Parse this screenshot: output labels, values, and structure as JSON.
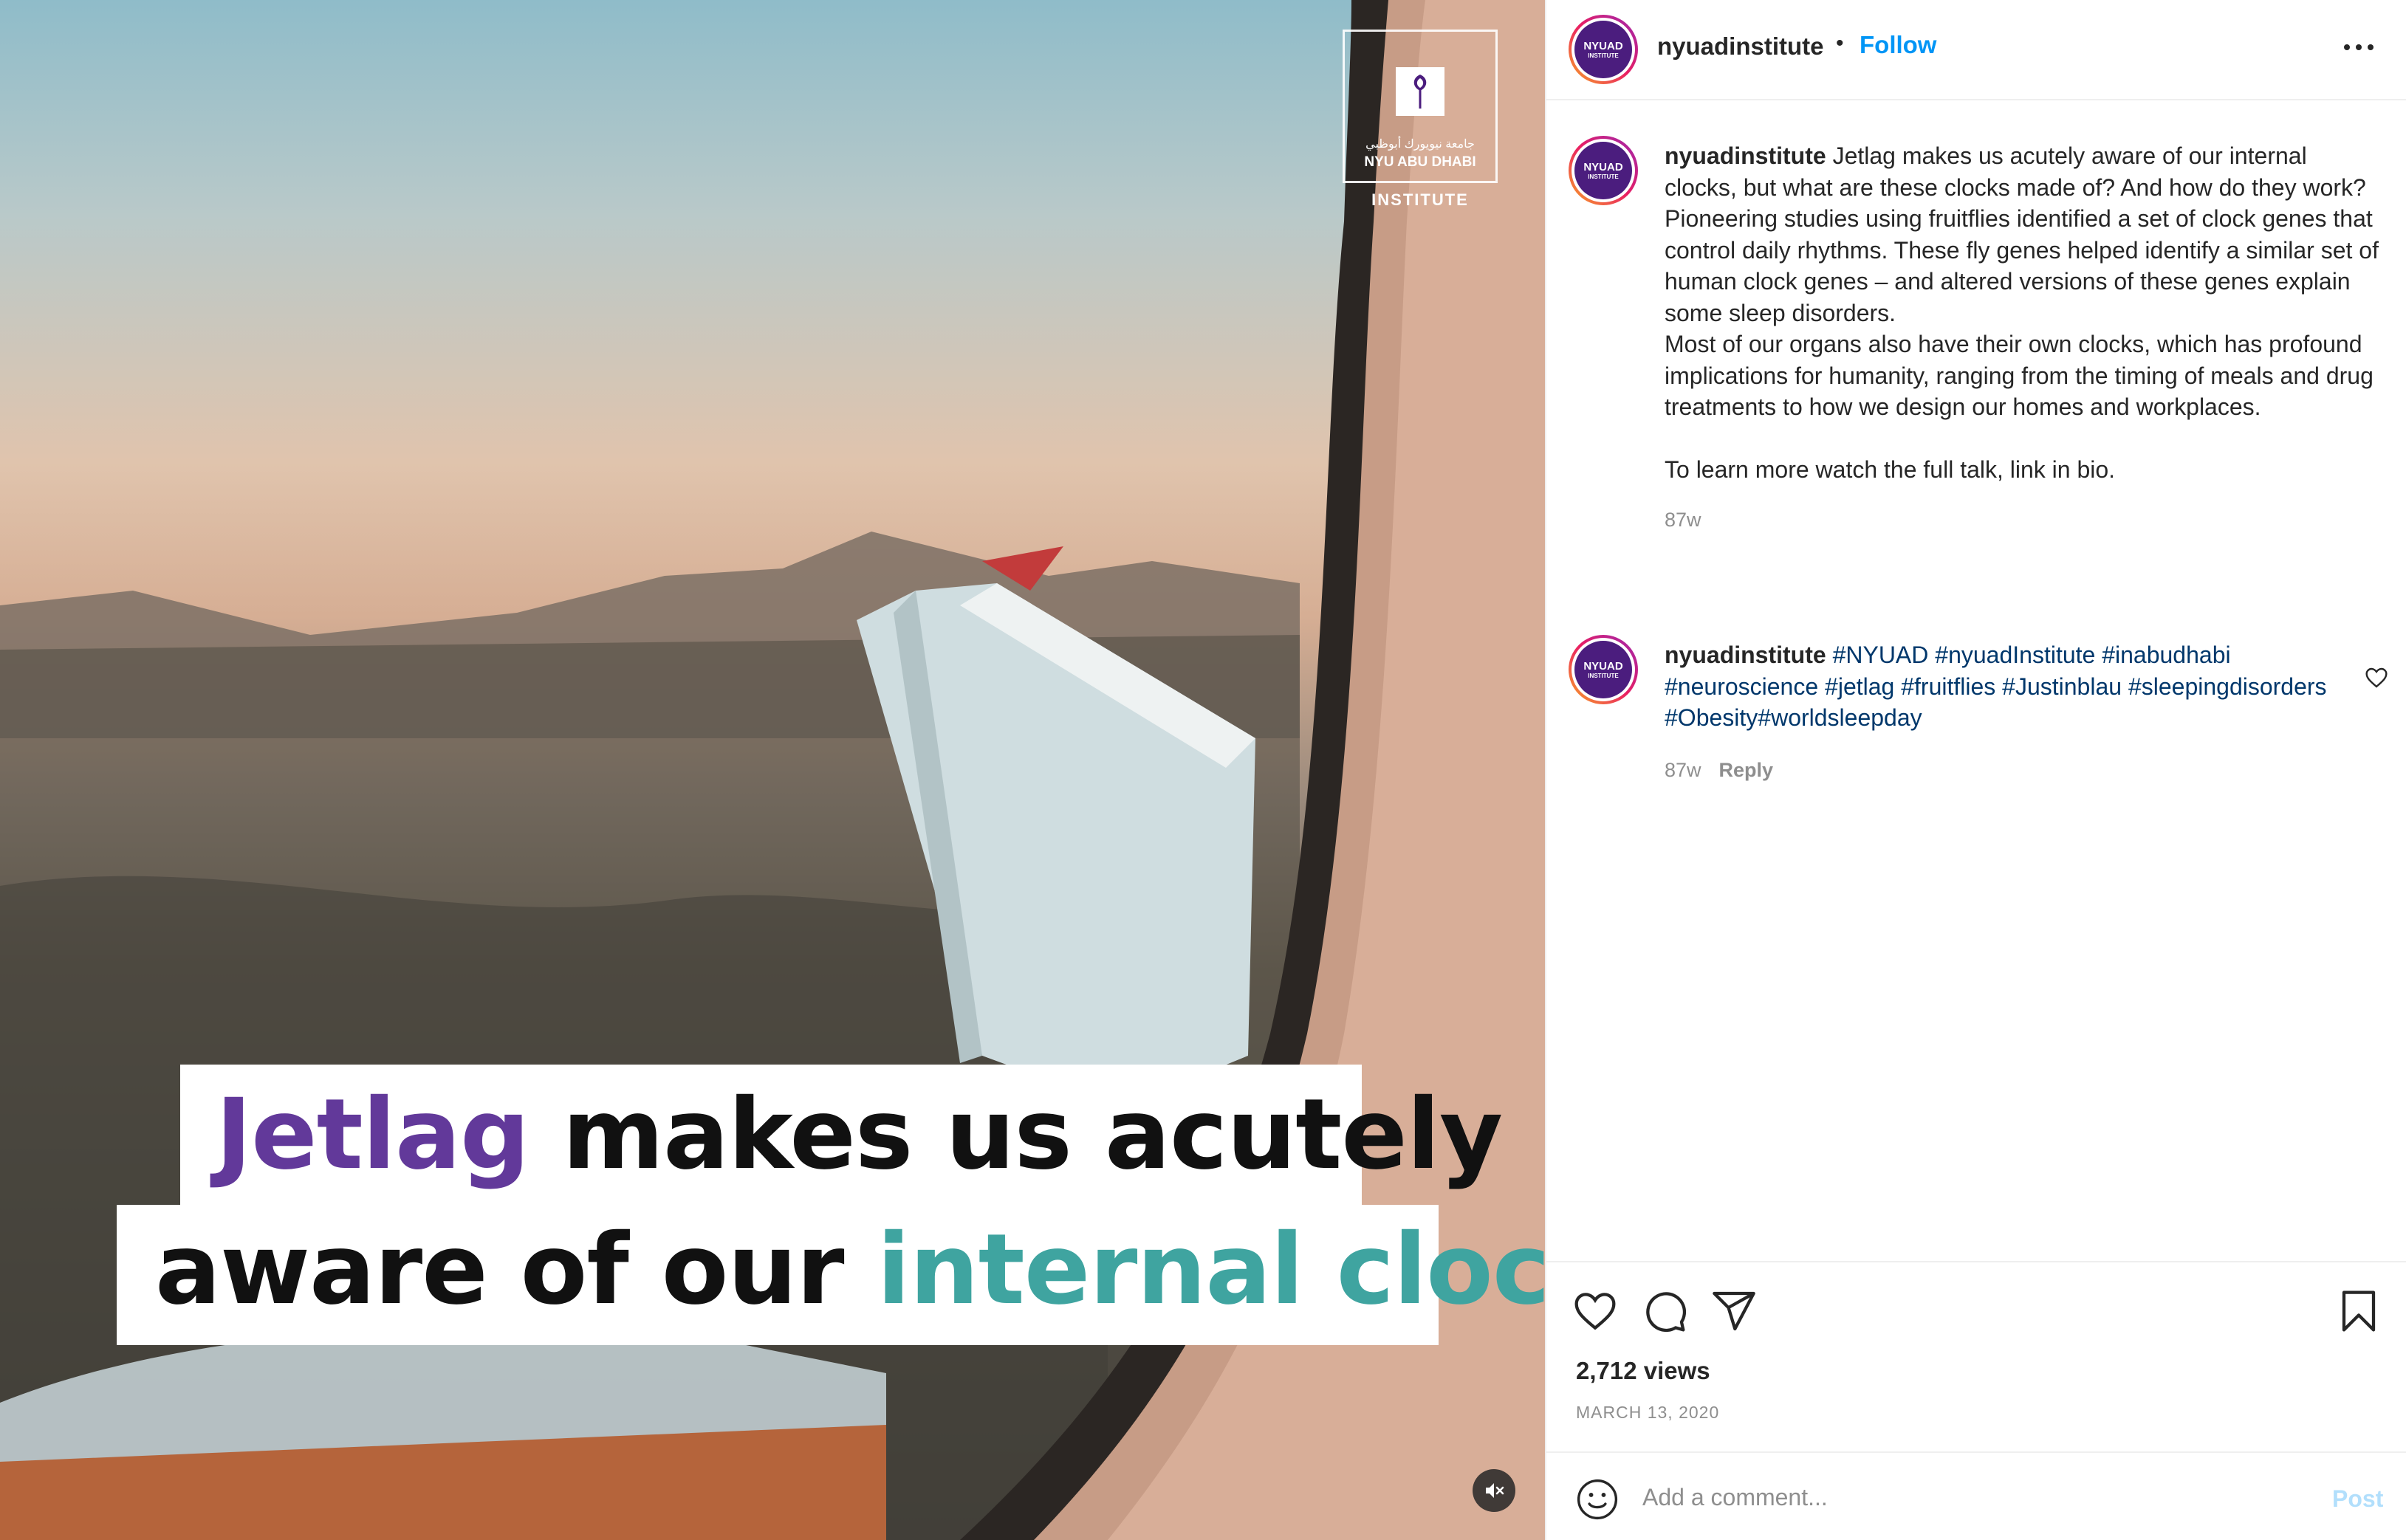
{
  "media": {
    "watermark": {
      "arabic": "جامعة نيويورك أبوظبي",
      "english": "NYU ABU DHABI",
      "sub": "INSTITUTE"
    },
    "caption_line1": {
      "highlight": "Jetlag",
      "rest": " makes us acutely"
    },
    "caption_line2": {
      "rest": "aware of our ",
      "highlight": "internal clocks"
    },
    "mute_icon": "speaker-muted-icon"
  },
  "header": {
    "avatar_text_1": "NYUAD",
    "avatar_text_2": "INSTITUTE",
    "username": "nyuadinstitute",
    "separator": "•",
    "follow_label": "Follow",
    "more_icon": "more-options-icon"
  },
  "caption": {
    "username": "nyuadinstitute",
    "p1": "Jetlag makes us acutely aware of our internal clocks, but what are these clocks made of? And how do they work?",
    "p2": "Pioneering studies using fruitflies identified a set of clock genes that control daily rhythms. These fly genes helped identify a similar set of human clock genes – and altered versions of these genes explain some sleep disorders.",
    "p3": "Most of our organs also have their own clocks, which has profound implications for humanity, ranging from the timing of meals and drug treatments to how we design our homes and workplaces.",
    "p4": "To learn more watch the full talk, link in bio.",
    "time": "87w"
  },
  "comment": {
    "username": "nyuadinstitute",
    "tags": [
      "#NYUAD",
      "#nyuadInstitute",
      "#inabudhabi",
      "#neuroscience",
      "#jetlag",
      "#fruitflies",
      "#Justinblau",
      "#sleepingdisorders",
      "#Obesity",
      "#worldsleepday"
    ],
    "time": "87w",
    "reply_label": "Reply",
    "like_icon": "heart-icon"
  },
  "actions": {
    "icons": [
      "heart-icon",
      "comment-icon",
      "share-icon",
      "bookmark-icon"
    ],
    "views": "2,712 views",
    "date": "MARCH 13, 2020"
  },
  "add_comment": {
    "placeholder": "Add a comment...",
    "post_label": "Post",
    "emoji_icon": "emoji-icon"
  },
  "colors": {
    "accent": "#0095f6",
    "hashtag": "#00376b",
    "caption_purple": "#62399a",
    "caption_teal": "#3fa4a0",
    "muted_text": "#8e8e8e"
  }
}
